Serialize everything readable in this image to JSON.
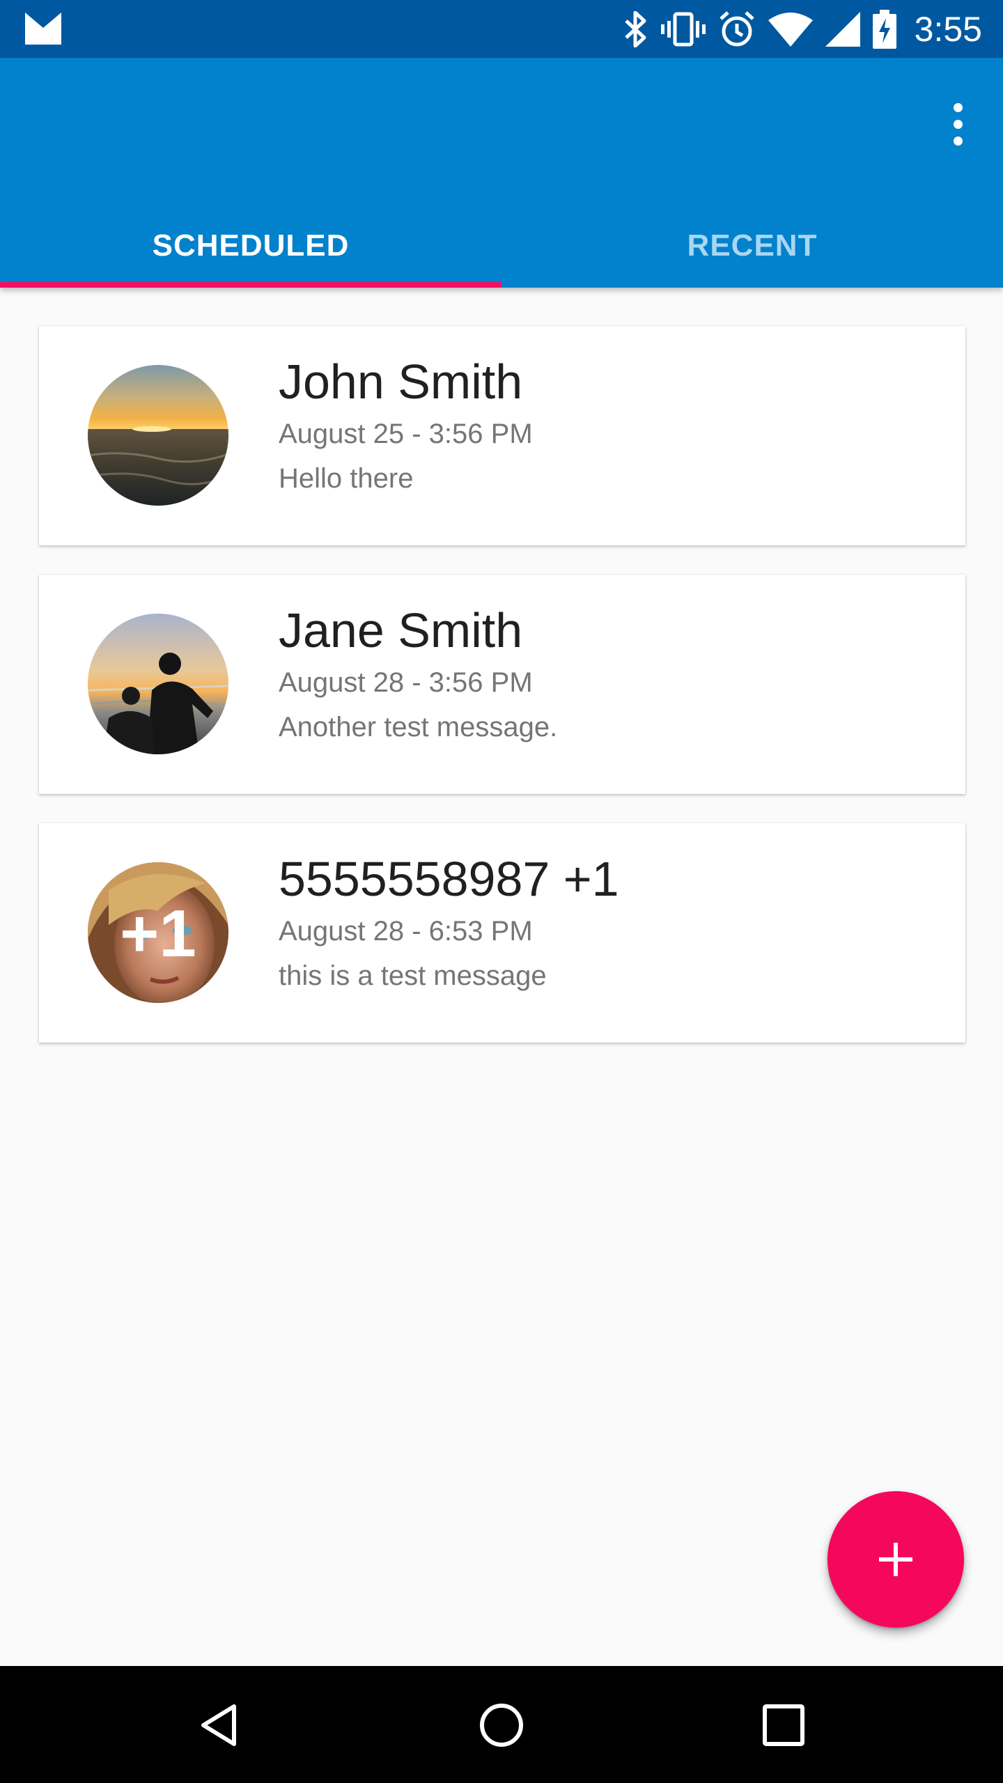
{
  "status_bar": {
    "time": "3:55",
    "icons": [
      "gmail-icon",
      "bluetooth-icon",
      "vibrate-icon",
      "alarm-icon",
      "wifi-icon",
      "signal-icon",
      "battery-charging-icon"
    ]
  },
  "app_bar": {
    "menu_icon": "more-vert-icon",
    "color": "#0281cc"
  },
  "tabs": [
    {
      "label": "SCHEDULED",
      "active": true
    },
    {
      "label": "RECENT",
      "active": false
    }
  ],
  "messages": [
    {
      "name": "John Smith",
      "date": "August 25 - 3:56 PM",
      "text": "Hello there",
      "avatar": "sunset-photo"
    },
    {
      "name": "Jane Smith",
      "date": "August 28 - 3:56 PM",
      "text": "Another test message.",
      "avatar": "couple-at-beach-photo"
    },
    {
      "name": "5555558987 +1",
      "date": "August 28 - 6:53 PM",
      "text": "this is a test message",
      "avatar": "portrait-photo",
      "avatar_badge": "+1"
    }
  ],
  "fab": {
    "icon": "add-icon",
    "color": "#f5075b"
  },
  "nav_bar": {
    "icons": [
      "back-icon",
      "home-icon",
      "recents-icon"
    ]
  },
  "colors": {
    "status_bar": "#0058a0",
    "accent": "#f11160",
    "tab_inactive": "#a8d6f3"
  }
}
